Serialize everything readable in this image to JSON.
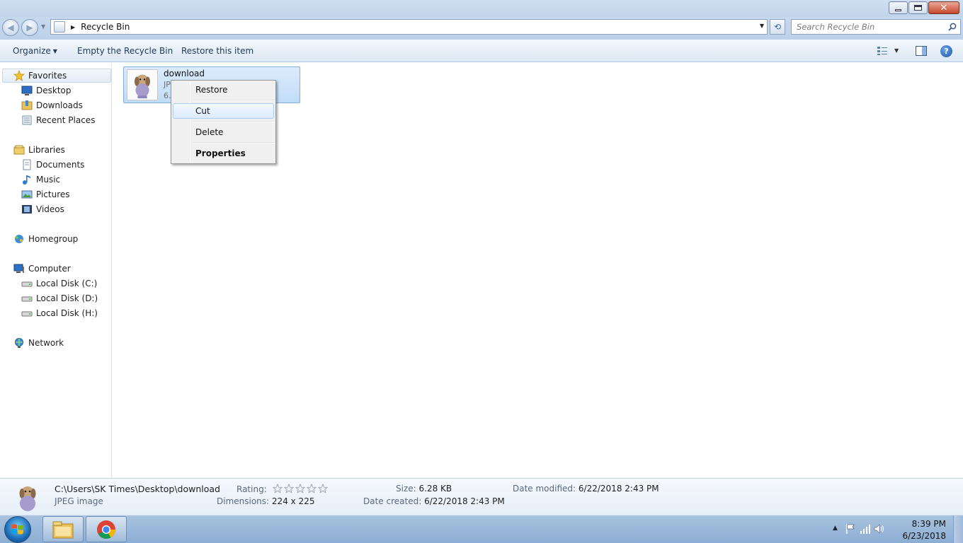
{
  "window": {
    "minimize_label": "minimize",
    "maximize_label": "maximize",
    "close_label": "close"
  },
  "address": {
    "location": "Recycle Bin",
    "search_placeholder": "Search Recycle Bin"
  },
  "commands": {
    "organize": "Organize",
    "empty": "Empty the Recycle Bin",
    "restore": "Restore this item"
  },
  "nav": {
    "favorites": "Favorites",
    "desktop": "Desktop",
    "downloads": "Downloads",
    "recent": "Recent Places",
    "libraries": "Libraries",
    "documents": "Documents",
    "music": "Music",
    "pictures": "Pictures",
    "videos": "Videos",
    "homegroup": "Homegroup",
    "computer": "Computer",
    "disk_c": "Local Disk (C:)",
    "disk_d": "Local Disk (D:)",
    "disk_h": "Local Disk (H:)",
    "network": "Network"
  },
  "file": {
    "name": "download",
    "type_partial": "JP",
    "size_partial": "6."
  },
  "context_menu": {
    "restore": "Restore",
    "cut": "Cut",
    "delete": "Delete",
    "properties": "Properties"
  },
  "details": {
    "path": "C:\\Users\\SK Times\\Desktop\\download",
    "type": "JPEG image",
    "rating_label": "Rating:",
    "rating_stars": 0,
    "dimensions_label": "Dimensions:",
    "dimensions": "224 x 225",
    "size_label": "Size:",
    "size": "6.28 KB",
    "created_label": "Date created:",
    "created": "6/22/2018 2:43 PM",
    "modified_label": "Date modified:",
    "modified": "6/22/2018 2:43 PM"
  },
  "taskbar": {
    "time": "8:39 PM",
    "date": "6/23/2018"
  },
  "colors": {
    "accent": "#1e395b",
    "selection": "#cce4fc",
    "close_button": "#c7452b"
  }
}
